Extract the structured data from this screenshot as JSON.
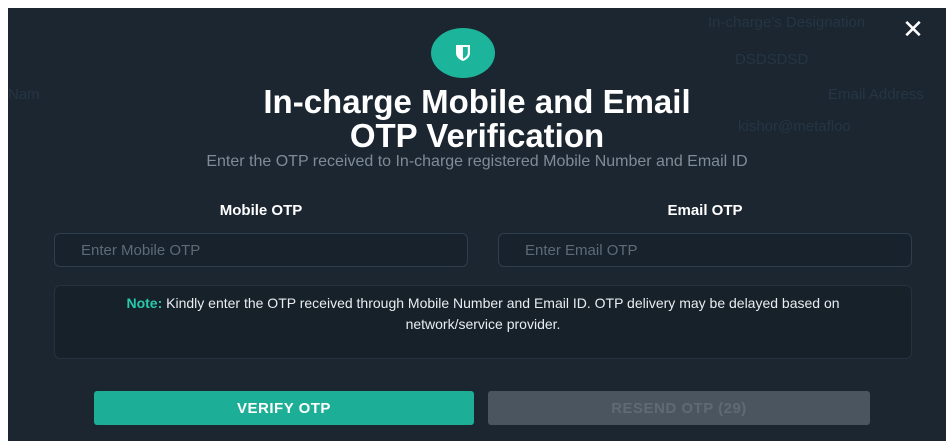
{
  "background_labels": {
    "bg1": "In-charge's Designation",
    "bg2": "DSDSDSD",
    "bg3": "Email Address",
    "bg4": "kishor@metafloo",
    "bg5": "Nam"
  },
  "modal": {
    "title_line1": "In-charge Mobile and Email",
    "title_line2": "OTP Verification",
    "subtitle": "Enter the OTP received to In-charge registered Mobile Number and Email ID",
    "mobile_label": "Mobile OTP",
    "email_label": "Email OTP",
    "mobile_placeholder": "Enter Mobile OTP",
    "email_placeholder": "Enter Email OTP",
    "note_label": "Note:",
    "note_text": " Kindly enter the OTP received through Mobile Number and Email ID. OTP delivery may be delayed based on network/service provider.",
    "verify_label": "VERIFY OTP",
    "resend_label": "RESEND OTP (29)",
    "close_glyph": "✕",
    "icon": "shield-icon"
  },
  "colors": {
    "accent": "#1cb49a",
    "background": "#1b2631",
    "note_accent": "#27c9ac",
    "disabled_button": "#4b5560"
  }
}
